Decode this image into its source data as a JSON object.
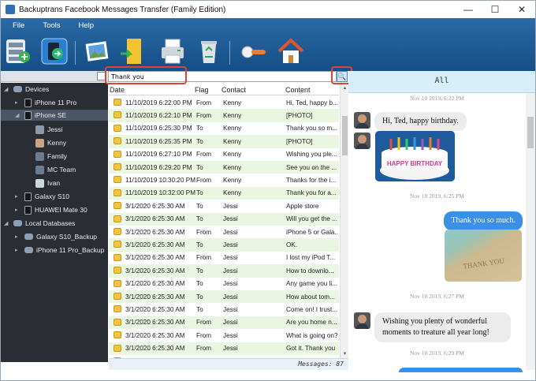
{
  "window": {
    "title": "Backuptrans Facebook Messages Transfer (Family Edition)",
    "minimize_icon": "minimize-icon",
    "maximize_icon": "maximize-icon",
    "close_icon": "close-icon"
  },
  "menu": [
    "File",
    "Tools",
    "Help"
  ],
  "toolbar": [
    {
      "name": "database-backup-icon"
    },
    {
      "name": "transfer-phone-icon"
    },
    {
      "name": "photo-export-icon"
    },
    {
      "name": "document-export-icon"
    },
    {
      "name": "print-icon"
    },
    {
      "name": "recycle-bin-icon"
    },
    {
      "name": "key-register-icon"
    },
    {
      "name": "home-icon"
    }
  ],
  "tree": {
    "devices_label": "Devices",
    "items": [
      {
        "label": "iPhone 11 Pro",
        "type": "phone"
      },
      {
        "label": "iPhone SE",
        "type": "phone",
        "selected": true
      },
      {
        "label": "Jessi",
        "type": "contact"
      },
      {
        "label": "Kenny",
        "type": "contact"
      },
      {
        "label": "Family",
        "type": "contact"
      },
      {
        "label": "MC Team",
        "type": "contact"
      },
      {
        "label": "Ivan",
        "type": "contact"
      },
      {
        "label": "Galaxy S10",
        "type": "phone"
      },
      {
        "label": "HUAWEI Mate 30",
        "type": "phone"
      }
    ],
    "local_label": "Local Databases",
    "local_items": [
      {
        "label": "Galaxy S10_Backup"
      },
      {
        "label": "iPhone 11 Pro_Backup"
      }
    ]
  },
  "search": {
    "value": "Thank you"
  },
  "columns": {
    "date": "Date",
    "flag": "Flag",
    "contact": "Contact",
    "content": "Content"
  },
  "rows": [
    {
      "date": "11/10/2019 6:22:00 PM",
      "flag": "From",
      "contact": "Kenny",
      "content": "Hi, Ted, happy b..."
    },
    {
      "date": "11/10/2019 6:22:10 PM",
      "flag": "From",
      "contact": "Kenny",
      "content": "[PHOTO]"
    },
    {
      "date": "11/10/2019 6:25:30 PM",
      "flag": "To",
      "contact": "Kenny",
      "content": "Thank you so m..."
    },
    {
      "date": "11/10/2019 6:25:35 PM",
      "flag": "To",
      "contact": "Kenny",
      "content": "[PHOTO]"
    },
    {
      "date": "11/10/2019 6:27:10 PM",
      "flag": "From",
      "contact": "Kenny",
      "content": "Wishing you ple..."
    },
    {
      "date": "11/10/2019 6:29:20 PM",
      "flag": "To",
      "contact": "Kenny",
      "content": "See you on the ..."
    },
    {
      "date": "11/10/2019 10:30:20 PM",
      "flag": "From",
      "contact": "Kenny",
      "content": "Thanks for the i..."
    },
    {
      "date": "11/10/2019 10:32:00 PM",
      "flag": "To",
      "contact": "Kenny",
      "content": "Thank you for a..."
    },
    {
      "date": "3/1/2020 6:25:30 AM",
      "flag": "To",
      "contact": "Jessi",
      "content": "Apple store"
    },
    {
      "date": "3/1/2020 6:25:30 AM",
      "flag": "To",
      "contact": "Jessi",
      "content": "Will you get the ..."
    },
    {
      "date": "3/1/2020 6:25:30 AM",
      "flag": "From",
      "contact": "Jessi",
      "content": "iPhone 5 or Gala..."
    },
    {
      "date": "3/1/2020 6:25:30 AM",
      "flag": "To",
      "contact": "Jessi",
      "content": "OK."
    },
    {
      "date": "3/1/2020 6:25:30 AM",
      "flag": "From",
      "contact": "Jessi",
      "content": "I lost my iPod T..."
    },
    {
      "date": "3/1/2020 6:25:30 AM",
      "flag": "To",
      "contact": "Jessi",
      "content": "How to downlo..."
    },
    {
      "date": "3/1/2020 6:25:30 AM",
      "flag": "To",
      "contact": "Jessi",
      "content": "Any game you li..."
    },
    {
      "date": "3/1/2020 6:25:30 AM",
      "flag": "To",
      "contact": "Jessi",
      "content": "How about tom..."
    },
    {
      "date": "3/1/2020 6:25:30 AM",
      "flag": "To",
      "contact": "Jessi",
      "content": "Come on! I trust..."
    },
    {
      "date": "3/1/2020 6:25:30 AM",
      "flag": "From",
      "contact": "Jessi",
      "content": "Are you home n..."
    },
    {
      "date": "3/1/2020 6:25:30 AM",
      "flag": "From",
      "contact": "Jessi",
      "content": "What is going on?"
    },
    {
      "date": "3/1/2020 6:25:30 AM",
      "flag": "From",
      "contact": "Jessi",
      "content": "Got it. Thank you"
    },
    {
      "date": "3/1/2020 6:25:30 AM",
      "flag": "To",
      "contact": "Jessi",
      "content": "Yes. You need to..."
    }
  ],
  "status": {
    "messages": "Messages: 87"
  },
  "chat": {
    "header": "All",
    "ts1": "Nov 10 2019, 6:22 PM",
    "msg1": "Hi, Ted, happy birthday.",
    "ts2": "Nov 10 2019, 6:25 PM",
    "msg2": "Thank you so much.",
    "ts3": "Nov 10 2019, 6:27 PM",
    "msg3_line1": "Wishing you plenty of wonderful",
    "msg3_line2": "moments to treature all year long!",
    "ts4": "Nov 10 2019, 6:29 PM",
    "cake_text": "HAPPY BIRTHDAY",
    "beach_text": "THANK YOU",
    "accent": "#3b8fe6"
  }
}
